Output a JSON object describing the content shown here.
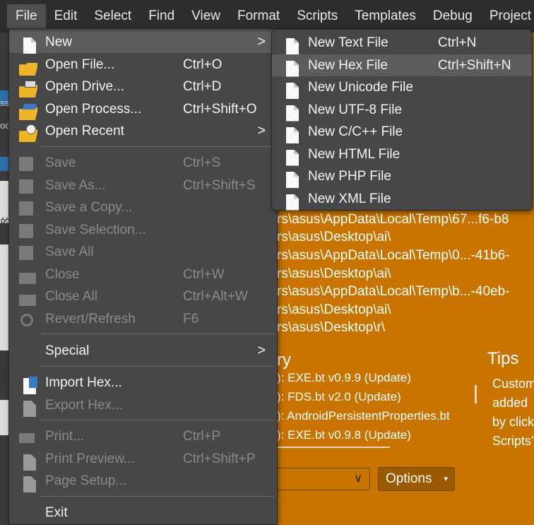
{
  "menubar": {
    "items": [
      "File",
      "Edit",
      "Select",
      "Find",
      "View",
      "Format",
      "Scripts",
      "Templates",
      "Debug",
      "Project"
    ]
  },
  "file_menu": {
    "items": [
      {
        "label": "New",
        "shortcut": "",
        "submenu": true,
        "enabled": true
      },
      {
        "label": "Open File...",
        "shortcut": "Ctrl+O",
        "enabled": true
      },
      {
        "label": "Open Drive...",
        "shortcut": "Ctrl+D",
        "enabled": true
      },
      {
        "label": "Open Process...",
        "shortcut": "Ctrl+Shift+O",
        "enabled": true
      },
      {
        "label": "Open Recent",
        "shortcut": "",
        "submenu": true,
        "enabled": true
      },
      {
        "label": "Save",
        "shortcut": "Ctrl+S",
        "enabled": false
      },
      {
        "label": "Save As...",
        "shortcut": "Ctrl+Shift+S",
        "enabled": false
      },
      {
        "label": "Save a Copy...",
        "shortcut": "",
        "enabled": false
      },
      {
        "label": "Save Selection...",
        "shortcut": "",
        "enabled": false
      },
      {
        "label": "Save All",
        "shortcut": "",
        "enabled": false
      },
      {
        "label": "Close",
        "shortcut": "Ctrl+W",
        "enabled": false
      },
      {
        "label": "Close All",
        "shortcut": "Ctrl+Alt+W",
        "enabled": false
      },
      {
        "label": "Revert/Refresh",
        "shortcut": "F6",
        "enabled": false
      },
      {
        "label": "Special",
        "shortcut": "",
        "submenu": true,
        "enabled": true
      },
      {
        "label": "Import Hex...",
        "shortcut": "",
        "enabled": true
      },
      {
        "label": "Export Hex...",
        "shortcut": "",
        "enabled": false
      },
      {
        "label": "Print...",
        "shortcut": "Ctrl+P",
        "enabled": false
      },
      {
        "label": "Print Preview...",
        "shortcut": "Ctrl+Shift+P",
        "enabled": false
      },
      {
        "label": "Page Setup...",
        "shortcut": "",
        "enabled": false
      },
      {
        "label": "Exit",
        "shortcut": "",
        "enabled": true
      }
    ],
    "arrow_glyph": ">"
  },
  "new_submenu": {
    "items": [
      {
        "label": "New Text File",
        "shortcut": "Ctrl+N"
      },
      {
        "label": "New Hex File",
        "shortcut": "Ctrl+Shift+N"
      },
      {
        "label": "New Unicode File",
        "shortcut": ""
      },
      {
        "label": "New UTF-8 File",
        "shortcut": ""
      },
      {
        "label": "New C/C++ File",
        "shortcut": ""
      },
      {
        "label": "New HTML File",
        "shortcut": ""
      },
      {
        "label": "New PHP File",
        "shortcut": ""
      },
      {
        "label": "New XML File",
        "shortcut": ""
      }
    ],
    "highlighted_index": 1
  },
  "background": {
    "recent_paths": [
      "rs\\asus\\AppData\\Local\\Temp\\67...f6-b8",
      "rs\\asus\\Desktop\\ai\\",
      "rs\\asus\\AppData\\Local\\Temp\\0...-41b6-",
      "rs\\asus\\Desktop\\ai\\",
      "rs\\asus\\AppData\\Local\\Temp\\b...-40eb-",
      "rs\\asus\\Desktop\\ai\\",
      "rs\\asus\\Desktop\\r\\"
    ],
    "history_title": "ry",
    "history_lines": [
      "): EXE.bt v0.9.9 (Update)",
      "): FDS.bt v2.0 (Update)",
      "): AndroidPersistentProperties.bt",
      "): EXE.bt v0.9.8 (Update)"
    ],
    "tips_title": "Tips",
    "tips_lines": [
      "Custom",
      "added",
      "by click",
      "Scripts'"
    ],
    "options_label": "Options",
    "options_caret": "▾",
    "select_chevron": "∨",
    "left_strip_glyphs": [
      "ss",
      "oc",
      "的",
      "汉"
    ]
  },
  "colors": {
    "menubar_bg": "#2d2d2d",
    "menu_bg": "#474747",
    "highlight_bg": "#5c5c5c",
    "accent_orange": "#c97400"
  }
}
